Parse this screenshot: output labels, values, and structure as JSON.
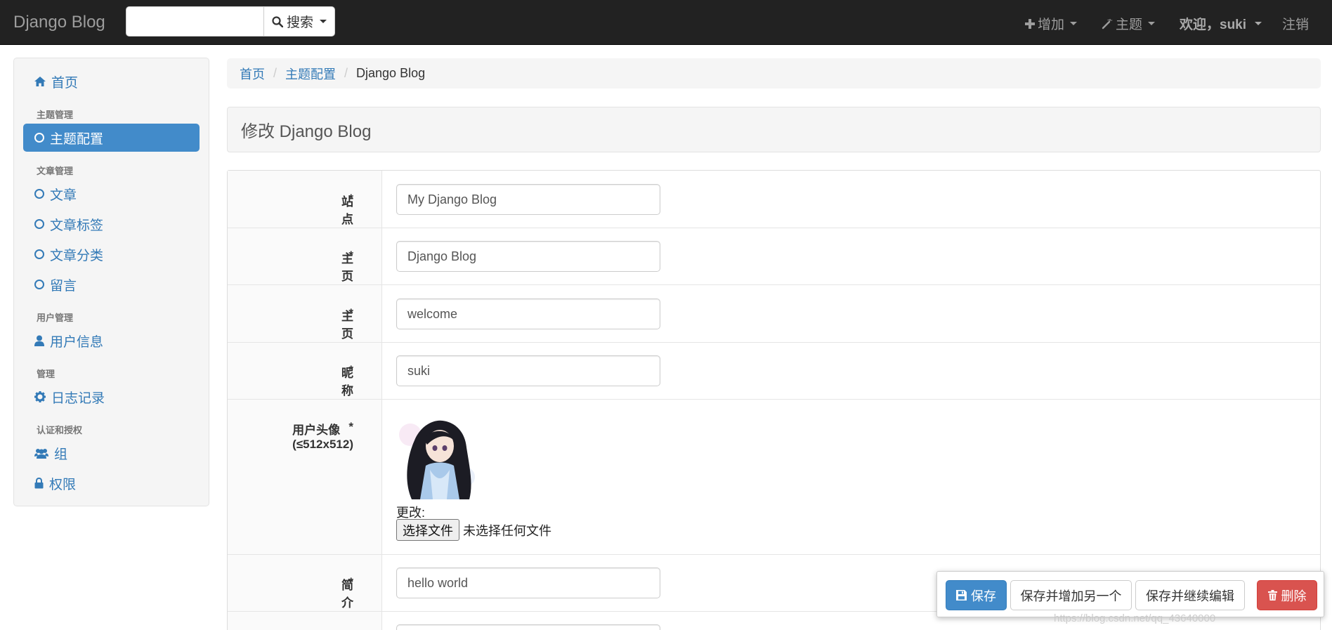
{
  "navbar": {
    "brand": "Django Blog",
    "search": {
      "value": "",
      "button_label": "搜索"
    },
    "add_label": "增加",
    "theme_label": "主题",
    "welcome_label": "欢迎，suki",
    "logout_label": "注销"
  },
  "sidebar": {
    "home": "首页",
    "sections": [
      {
        "header": "主题管理",
        "items": [
          "主题配置"
        ]
      },
      {
        "header": "文章管理",
        "items": [
          "文章",
          "文章标签",
          "文章分类",
          "留言"
        ]
      },
      {
        "header": "用户管理",
        "items": [
          "用户信息"
        ]
      },
      {
        "header": "管理",
        "items": [
          "日志记录"
        ]
      },
      {
        "header": "认证和授权",
        "items": [
          "组",
          "权限"
        ]
      }
    ],
    "active_item": "主题配置"
  },
  "breadcrumb": [
    "首页",
    "主题配置",
    "Django Blog"
  ],
  "page_title": "修改 Django Blog",
  "form": {
    "site_title": {
      "label": "站点标题",
      "value": "My Django Blog"
    },
    "home_title": {
      "label": "主页标题",
      "value": "Django Blog"
    },
    "home_subtitle": {
      "label": "主页副标题",
      "value": "welcome"
    },
    "nickname": {
      "label": "昵称",
      "value": "suki"
    },
    "avatar": {
      "label": "用户头像(≤512x512)",
      "change_label": "更改:",
      "file_button": "选择文件",
      "file_status": "未选择任何文件"
    },
    "bio": {
      "label": "简介",
      "value": "hello world"
    },
    "required_mark": "*"
  },
  "actions": {
    "save": "保存",
    "save_add": "保存并增加另一个",
    "save_continue": "保存并继续编辑",
    "delete": "删除"
  },
  "watermark": "https://blog.csdn.net/qq_43640000"
}
